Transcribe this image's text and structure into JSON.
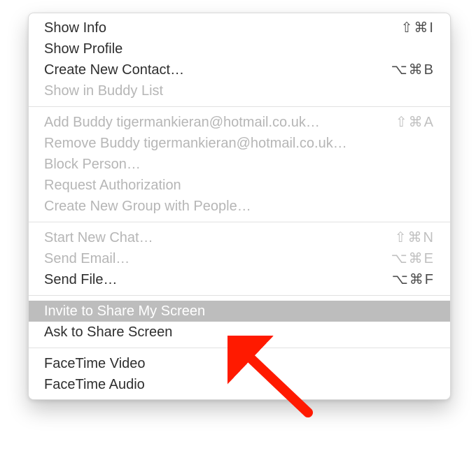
{
  "menu": {
    "groups": [
      [
        {
          "label": "Show Info",
          "shortcut": "⇧⌘I",
          "enabled": true
        },
        {
          "label": "Show Profile",
          "shortcut": "",
          "enabled": true
        },
        {
          "label": "Create New Contact…",
          "shortcut": "⌥⌘B",
          "enabled": true
        },
        {
          "label": "Show in Buddy List",
          "shortcut": "",
          "enabled": false
        }
      ],
      [
        {
          "label": "Add Buddy tigermankieran@hotmail.co.uk…",
          "shortcut": "⇧⌘A",
          "enabled": false
        },
        {
          "label": "Remove Buddy tigermankieran@hotmail.co.uk…",
          "shortcut": "",
          "enabled": false
        },
        {
          "label": "Block Person…",
          "shortcut": "",
          "enabled": false
        },
        {
          "label": "Request Authorization",
          "shortcut": "",
          "enabled": false
        },
        {
          "label": "Create New Group with People…",
          "shortcut": "",
          "enabled": false
        }
      ],
      [
        {
          "label": "Start New Chat…",
          "shortcut": "⇧⌘N",
          "enabled": false
        },
        {
          "label": "Send Email…",
          "shortcut": "⌥⌘E",
          "enabled": false
        },
        {
          "label": "Send File…",
          "shortcut": "⌥⌘F",
          "enabled": true
        }
      ],
      [
        {
          "label": "Invite to Share My Screen",
          "shortcut": "",
          "enabled": true,
          "highlight": true
        },
        {
          "label": "Ask to Share Screen",
          "shortcut": "",
          "enabled": true
        }
      ],
      [
        {
          "label": "FaceTime Video",
          "shortcut": "",
          "enabled": true
        },
        {
          "label": "FaceTime Audio",
          "shortcut": "",
          "enabled": true
        }
      ]
    ]
  },
  "annotation": {
    "arrow_color": "#ff1a00"
  }
}
